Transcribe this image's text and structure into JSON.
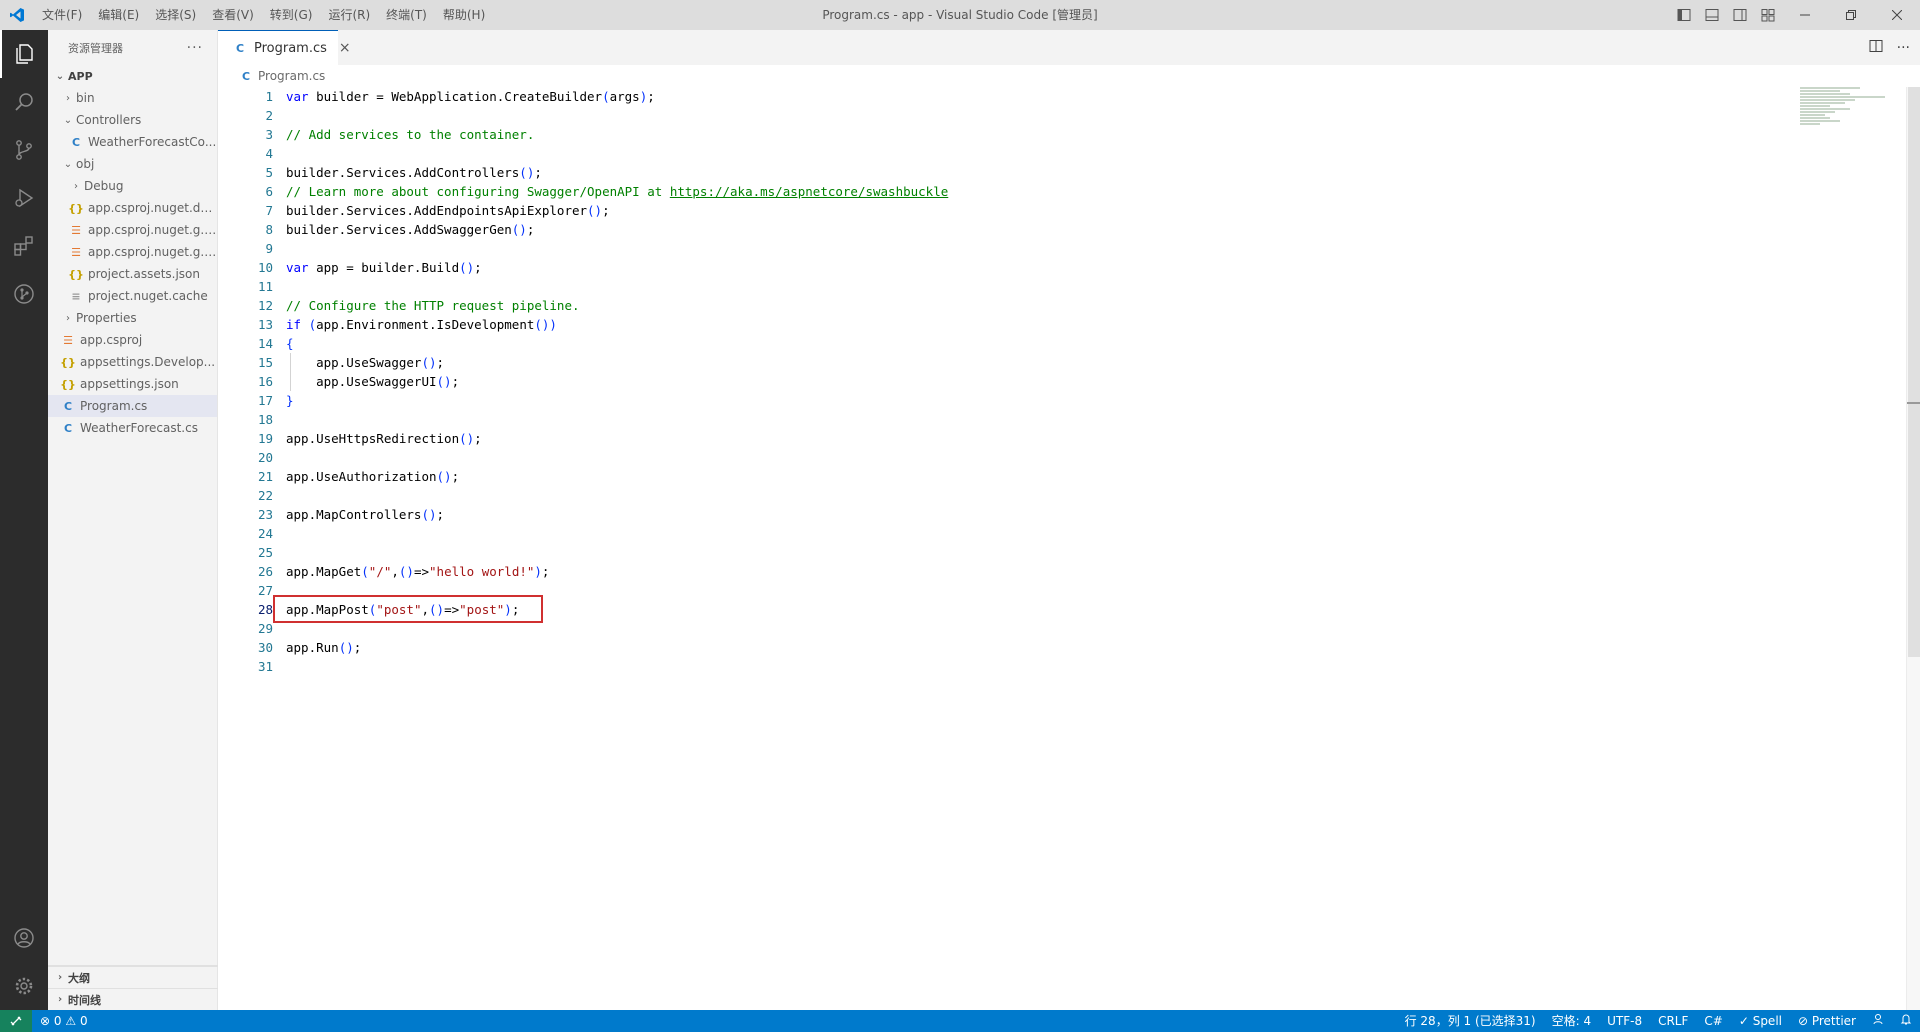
{
  "titlebar": {
    "menus": [
      "文件(F)",
      "编辑(E)",
      "选择(S)",
      "查看(V)",
      "转到(G)",
      "运行(R)",
      "终端(T)",
      "帮助(H)"
    ],
    "title": "Program.cs - app - Visual Studio Code [管理员]"
  },
  "sidebar": {
    "header": "资源管理器",
    "more": "···",
    "root": "APP",
    "items": [
      {
        "label": "bin",
        "type": "folder",
        "expanded": false,
        "depth": 0
      },
      {
        "label": "Controllers",
        "type": "folder",
        "expanded": true,
        "depth": 0
      },
      {
        "label": "WeatherForecastCo...",
        "type": "cs",
        "depth": 1
      },
      {
        "label": "obj",
        "type": "folder",
        "expanded": true,
        "depth": 0
      },
      {
        "label": "Debug",
        "type": "folder",
        "expanded": false,
        "depth": 1
      },
      {
        "label": "app.csproj.nuget.dg...",
        "type": "json",
        "depth": 1
      },
      {
        "label": "app.csproj.nuget.g.p...",
        "type": "rss",
        "depth": 1
      },
      {
        "label": "app.csproj.nuget.g.t...",
        "type": "rss",
        "depth": 1
      },
      {
        "label": "project.assets.json",
        "type": "json",
        "depth": 1
      },
      {
        "label": "project.nuget.cache",
        "type": "plain",
        "depth": 1
      },
      {
        "label": "Properties",
        "type": "folder",
        "expanded": false,
        "depth": 0
      },
      {
        "label": "app.csproj",
        "type": "rss",
        "depth": 0
      },
      {
        "label": "appsettings.Develop...",
        "type": "json",
        "depth": 0
      },
      {
        "label": "appsettings.json",
        "type": "json",
        "depth": 0
      },
      {
        "label": "Program.cs",
        "type": "cs",
        "depth": 0,
        "selected": true
      },
      {
        "label": "WeatherForecast.cs",
        "type": "cs",
        "depth": 0
      }
    ],
    "outline": "大纲",
    "timeline": "时间线"
  },
  "editor": {
    "tab": "Program.cs",
    "breadcrumb": "Program.cs",
    "active_line": 28,
    "lines": [
      {
        "n": "1",
        "indent": 0,
        "tokens": [
          {
            "t": "var",
            "c": "kw"
          },
          {
            "t": " builder = WebApplication.CreateBuilder"
          },
          {
            "t": "(",
            "c": "br"
          },
          {
            "t": "args"
          },
          {
            "t": ")",
            "c": "br"
          },
          {
            "t": ";"
          }
        ]
      },
      {
        "n": "2",
        "indent": 0,
        "tokens": []
      },
      {
        "n": "3",
        "indent": 0,
        "tokens": [
          {
            "t": "// Add services to the container.",
            "c": "cm"
          }
        ]
      },
      {
        "n": "4",
        "indent": 0,
        "tokens": []
      },
      {
        "n": "5",
        "indent": 0,
        "tokens": [
          {
            "t": "builder.Services.AddControllers"
          },
          {
            "t": "()",
            "c": "br"
          },
          {
            "t": ";"
          }
        ]
      },
      {
        "n": "6",
        "indent": 0,
        "tokens": [
          {
            "t": "// Learn more about configuring Swagger/OpenAPI at ",
            "c": "cm"
          },
          {
            "t": "https://aka.ms/aspnetcore/swashbuckle",
            "c": "link"
          }
        ]
      },
      {
        "n": "7",
        "indent": 0,
        "tokens": [
          {
            "t": "builder.Services.AddEndpointsApiExplorer"
          },
          {
            "t": "()",
            "c": "br"
          },
          {
            "t": ";"
          }
        ]
      },
      {
        "n": "8",
        "indent": 0,
        "tokens": [
          {
            "t": "builder.Services.AddSwaggerGen"
          },
          {
            "t": "()",
            "c": "br"
          },
          {
            "t": ";"
          }
        ]
      },
      {
        "n": "9",
        "indent": 0,
        "tokens": []
      },
      {
        "n": "10",
        "indent": 0,
        "tokens": [
          {
            "t": "var",
            "c": "kw"
          },
          {
            "t": " app = builder.Build"
          },
          {
            "t": "()",
            "c": "br"
          },
          {
            "t": ";"
          }
        ]
      },
      {
        "n": "11",
        "indent": 0,
        "tokens": []
      },
      {
        "n": "12",
        "indent": 0,
        "tokens": [
          {
            "t": "// Configure the HTTP request pipeline.",
            "c": "cm"
          }
        ]
      },
      {
        "n": "13",
        "indent": 0,
        "tokens": [
          {
            "t": "if",
            "c": "kw"
          },
          {
            "t": " "
          },
          {
            "t": "(",
            "c": "br"
          },
          {
            "t": "app.Environment.IsDevelopment"
          },
          {
            "t": "())",
            "c": "br"
          }
        ]
      },
      {
        "n": "14",
        "indent": 0,
        "tokens": [
          {
            "t": "{",
            "c": "br"
          }
        ]
      },
      {
        "n": "15",
        "indent": 1,
        "tokens": [
          {
            "t": "    app.UseSwagger"
          },
          {
            "t": "()",
            "c": "br"
          },
          {
            "t": ";"
          }
        ]
      },
      {
        "n": "16",
        "indent": 1,
        "tokens": [
          {
            "t": "    app.UseSwaggerUI"
          },
          {
            "t": "()",
            "c": "br"
          },
          {
            "t": ";"
          }
        ]
      },
      {
        "n": "17",
        "indent": 0,
        "tokens": [
          {
            "t": "}",
            "c": "br"
          }
        ]
      },
      {
        "n": "18",
        "indent": 0,
        "tokens": []
      },
      {
        "n": "19",
        "indent": 0,
        "tokens": [
          {
            "t": "app.UseHttpsRedirection"
          },
          {
            "t": "()",
            "c": "br"
          },
          {
            "t": ";"
          }
        ]
      },
      {
        "n": "20",
        "indent": 0,
        "tokens": []
      },
      {
        "n": "21",
        "indent": 0,
        "tokens": [
          {
            "t": "app.UseAuthorization"
          },
          {
            "t": "()",
            "c": "br"
          },
          {
            "t": ";"
          }
        ]
      },
      {
        "n": "22",
        "indent": 0,
        "tokens": []
      },
      {
        "n": "23",
        "indent": 0,
        "tokens": [
          {
            "t": "app.MapControllers"
          },
          {
            "t": "()",
            "c": "br"
          },
          {
            "t": ";"
          }
        ]
      },
      {
        "n": "24",
        "indent": 0,
        "tokens": []
      },
      {
        "n": "25",
        "indent": 0,
        "tokens": []
      },
      {
        "n": "26",
        "indent": 0,
        "tokens": [
          {
            "t": "app.MapGet"
          },
          {
            "t": "(",
            "c": "br"
          },
          {
            "t": "\"/\"",
            "c": "str"
          },
          {
            "t": ","
          },
          {
            "t": "()",
            "c": "br"
          },
          {
            "t": "=>"
          },
          {
            "t": "\"hello world!\"",
            "c": "str"
          },
          {
            "t": ")",
            "c": "br"
          },
          {
            "t": ";"
          }
        ]
      },
      {
        "n": "27",
        "indent": 0,
        "tokens": []
      },
      {
        "n": "28",
        "indent": 0,
        "tokens": [
          {
            "t": "app.MapPost"
          },
          {
            "t": "(",
            "c": "br"
          },
          {
            "t": "\"post\"",
            "c": "str"
          },
          {
            "t": ","
          },
          {
            "t": "()",
            "c": "br"
          },
          {
            "t": "=>"
          },
          {
            "t": "\"post\"",
            "c": "str"
          },
          {
            "t": ")",
            "c": "br"
          },
          {
            "t": ";"
          }
        ]
      },
      {
        "n": "29",
        "indent": 0,
        "tokens": []
      },
      {
        "n": "30",
        "indent": 0,
        "tokens": [
          {
            "t": "app.Run"
          },
          {
            "t": "()",
            "c": "br"
          },
          {
            "t": ";"
          }
        ]
      },
      {
        "n": "31",
        "indent": 0,
        "tokens": []
      }
    ]
  },
  "statusbar": {
    "errors": "0",
    "warnings": "0",
    "position": "行 28，列 1 (已选择31)",
    "spaces": "空格: 4",
    "encoding": "UTF-8",
    "eol": "CRLF",
    "language": "C#",
    "spell": "✓ Spell",
    "prettier": "⊘ Prettier"
  },
  "colors": {
    "accent": "#007acc",
    "remote": "#16825d",
    "activitybar": "#2c2c2c",
    "highlight": "#d03030"
  }
}
